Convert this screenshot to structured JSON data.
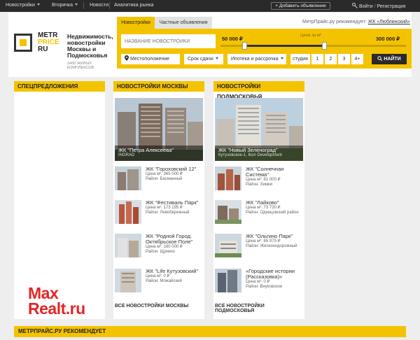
{
  "topnav": {
    "items": [
      "Новостройки",
      "Вторичка",
      "Новости",
      "Аналитика рынка"
    ],
    "add_ad": "+ Добавить объявление",
    "login": "Войти",
    "register": "Регистрация"
  },
  "header": {
    "logo_line1": "METR",
    "logo_line2": "PRICE",
    "logo_line3": "RU",
    "tagline": "Недвижимость, новостройки Москвы и Подмосковья",
    "tagline_sub": "2400 ЖИЛЫХ КОМПЛЕКСОВ",
    "tab_new": "Новостройки",
    "tab_private": "Частные объявления",
    "recommend_prefix": "МетрПрайс.ру рекомендует:",
    "recommend_link": "ЖК «Люблинский»"
  },
  "search": {
    "placeholder": "НАЗВАНИЕ НОВОСТРОЙКИ",
    "price_min": "50 000 ₽",
    "price_max": "300 000 ₽",
    "price_label": "Цена за м²",
    "slider_low": 0.13,
    "slider_high": 0.56,
    "location": "Местоположение",
    "deadline": "Срок сдачи",
    "mortgage": "Ипотека и рассрочка",
    "rooms": [
      "студия",
      "1",
      "2",
      "3",
      "4+"
    ],
    "find": "НАЙТИ"
  },
  "special": {
    "title": "СПЕЦПРЕДЛОЖЕНИЯ"
  },
  "moscow": {
    "title": "НОВОСТРОЙКИ МОСКВЫ",
    "featured_name": "ЖК \"Петра Алексеева\"",
    "featured_dev": "INGRAD",
    "items": [
      {
        "name": "ЖК \"Гороховский 12\"",
        "price": "Цена м²: 365 000 ₽",
        "district": "Район: Басманный"
      },
      {
        "name": "ЖК \"Фестиваль Парк\"",
        "price": "Цена м²: 173 195 ₽",
        "district": "Район: Левобережный"
      },
      {
        "name": "ЖК \"Родной Город. Октябрьское Поле\"",
        "price": "Цена м²: 180 000 ₽",
        "district": "Район: Щукино"
      },
      {
        "name": "ЖК \"Life Кутузовский\"",
        "price": "Цена м²: 0 ₽",
        "district": "Район: Можайский"
      }
    ],
    "all_link": "ВСЕ НОВОСТРОЙКИ МОСКВЫ"
  },
  "mo": {
    "title": "НОВОСТРОЙКИ ПОДМОСКОВЬЯ",
    "featured_name": "ЖК \"Новый Зеленоград\"",
    "featured_dev": "Кутузовское-1, Ikon Development",
    "items": [
      {
        "name": "ЖК \"Солнечная Система\"",
        "price": "Цена м²: 81 000 ₽",
        "district": "Район: Химки"
      },
      {
        "name": "ЖК \"Лайково\"",
        "price": "Цена м²: 73 730 ₽",
        "district": "Район: Одинцовский район"
      },
      {
        "name": "ЖК \"Ольгино Парк\"",
        "price": "Цена м²: 65 975 ₽",
        "district": "Район: Железнодорожный"
      },
      {
        "name": "«Городские истории (Рассказовка)»",
        "price": "Цена м²: 0 ₽",
        "district": "Район: Внуковское"
      }
    ],
    "all_link": "ВСЕ НОВОСТРОЙКИ ПОДМОСКОВЬЯ"
  },
  "recommend_bar": "МЕТРПРАЙС.РУ РЕКОМЕНДУЕТ",
  "watermark": {
    "line1": "Max",
    "line2": "Realt.ru"
  },
  "colors": {
    "accent": "#f4c300",
    "nav": "#2a2a2a",
    "watermark": "#e62424"
  }
}
